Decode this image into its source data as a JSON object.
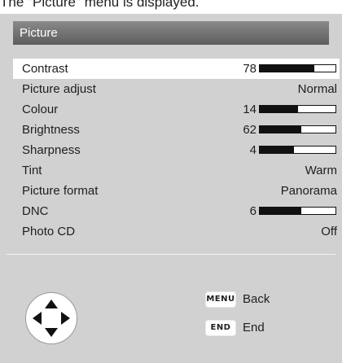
{
  "caption": "The \"Picture\" menu is displayed.",
  "menu": {
    "title": "Picture",
    "items": [
      {
        "label": "Contrast",
        "number": "78",
        "level": 0.72,
        "selected": true
      },
      {
        "label": "Picture adjust",
        "value": "Normal"
      },
      {
        "label": "Colour",
        "number": "14",
        "level": 0.5
      },
      {
        "label": "Brightness",
        "number": "62",
        "level": 0.55
      },
      {
        "label": "Sharpness",
        "number": "4",
        "level": 0.45
      },
      {
        "label": "Tint",
        "value": "Warm"
      },
      {
        "label": "Picture format",
        "value": "Panorama"
      },
      {
        "label": "DNC",
        "number": "6",
        "level": 0.55
      },
      {
        "label": "Photo CD",
        "value": "Off"
      }
    ]
  },
  "footer": {
    "nav_icon": "four-way-arrow-pad-icon",
    "keys": [
      {
        "key": "MENU",
        "label": "Back"
      },
      {
        "key": "END",
        "label": "End"
      }
    ]
  }
}
